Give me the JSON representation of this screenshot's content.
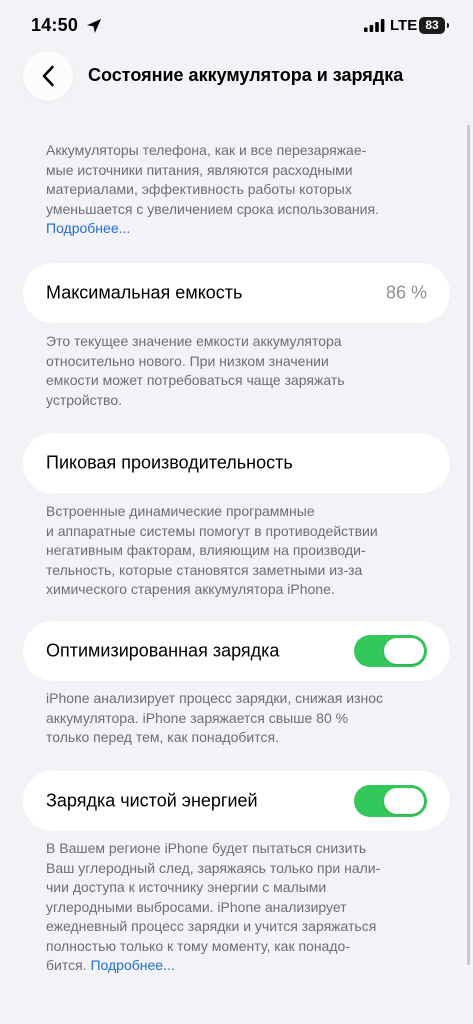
{
  "status_bar": {
    "time": "14:50",
    "network": "LTE",
    "battery_level": "83",
    "location_icon": "location-arrow-icon",
    "signal_icon": "cellular-signal-icon"
  },
  "nav": {
    "back_icon": "chevron-left-icon",
    "title": "Состояние аккумулятора и зарядка"
  },
  "intro": {
    "text": "Аккумуляторы телефона, как и все перезаряжае-мые источники питания, являются расходными материалами, эффективность работы которых уменьшается с увеличением срока использования.",
    "lines": [
      "Аккумуляторы телефона, как и все перезаряжае-",
      "мые источники питания, являются расходными",
      "материалами, эффективность работы которых",
      "уменьшается с увеличением срока использования."
    ],
    "link": "Подробнее..."
  },
  "max_capacity": {
    "label": "Максимальная емкость",
    "value": "86 %",
    "note_lines": [
      "Это текущее значение емкости аккумулятора",
      "относительно нового. При низком значении",
      "емкости может потребоваться чаще заряжать",
      "устройство."
    ]
  },
  "peak_performance": {
    "label": "Пиковая производительность",
    "note_lines": [
      "Встроенные динамические программные",
      "и аппаратные системы помогут в противодействии",
      "негативным факторам, влияющим на производи-",
      "тельность, которые становятся заметными из-за",
      "химического старения аккумулятора iPhone."
    ]
  },
  "optimized_charging": {
    "label": "Оптимизированная зарядка",
    "enabled": true,
    "note_lines": [
      "iPhone анализирует процесс зарядки, снижая износ",
      "аккумулятора. iPhone заряжается свыше 80 %",
      "только перед тем, как понадобится."
    ]
  },
  "clean_energy": {
    "label": "Зарядка чистой энергией",
    "enabled": true,
    "note_lines": [
      "В Вашем регионе iPhone будет пытаться снизить",
      "Ваш углеродный след, заряжаясь только при нали-",
      "чии доступа к источнику энергии с малыми",
      "углеродными выбросами. iPhone анализирует",
      "ежедневный процесс зарядки и учится заряжаться",
      "полностью только к тому моменту, как понадо-"
    ],
    "last_line": "бится.",
    "link": "Подробнее..."
  },
  "colors": {
    "toggle_on": "#34c759",
    "link": "#1f6fd1",
    "background": "#f2f2f7"
  }
}
